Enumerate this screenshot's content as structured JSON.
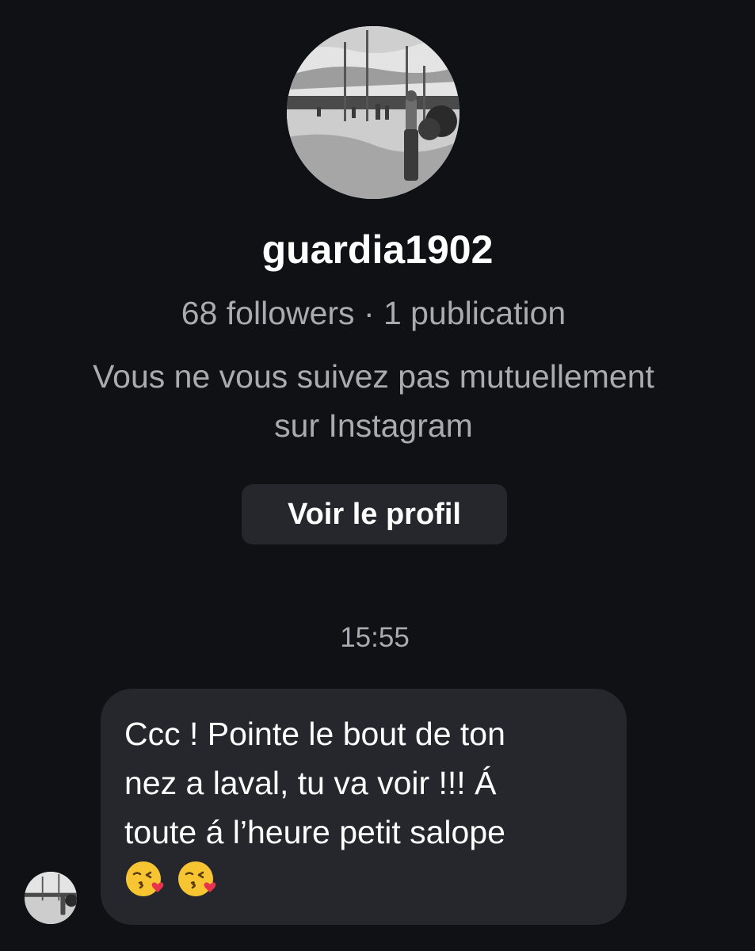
{
  "profile": {
    "username": "guardia1902",
    "stats": "68 followers · 1 publication",
    "mutual_line1": "Vous ne vous suivez pas mutuellement",
    "mutual_line2": "sur Instagram",
    "view_profile_label": "Voir le profil"
  },
  "conversation": {
    "timestamp": "15:55",
    "messages": [
      {
        "sender": "guardia1902",
        "text": "Ccc ! Pointe le bout de ton\nnez a laval, tu va voir !!! Á\ntoute á l’heure petit salope",
        "emojis": [
          "kissing-heart-emoji",
          "kissing-heart-emoji"
        ]
      }
    ]
  },
  "colors": {
    "background": "#0f1115",
    "bubble": "#25272d",
    "secondary_text": "#a9abb1",
    "primary_text": "#ffffff"
  }
}
